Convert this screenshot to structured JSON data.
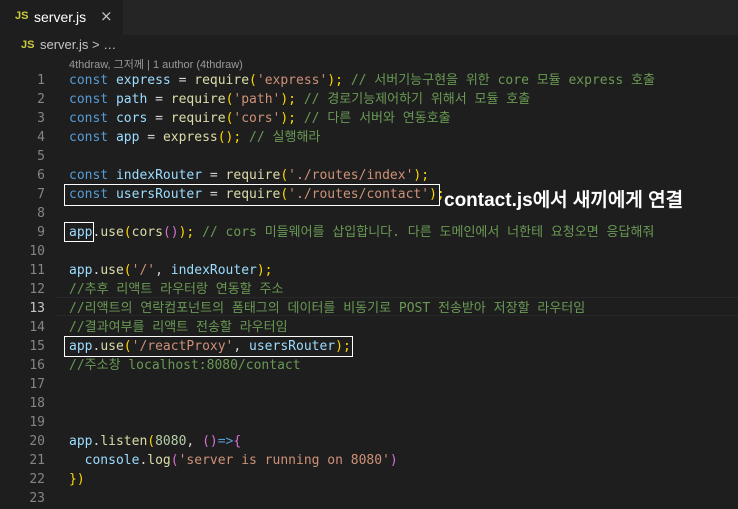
{
  "tab": {
    "icon": "JS",
    "file": "server.js",
    "close": "×"
  },
  "breadcrumb": {
    "icon": "JS",
    "path": "server.js > …"
  },
  "blame": "4thdraw, 그저께 | 1 author (4thdraw)",
  "line_numbers": [
    "1",
    "2",
    "3",
    "4",
    "5",
    "6",
    "7",
    "8",
    "9",
    "10",
    "11",
    "12",
    "13",
    "14",
    "15",
    "16",
    "17",
    "18",
    "19",
    "20",
    "21",
    "22",
    "23"
  ],
  "code": {
    "l1": [
      "const",
      "express",
      "=",
      "require",
      "(",
      "'express'",
      ");",
      "// 서버기능구현을 위한 core 모듈 express 호출"
    ],
    "l2": [
      "const",
      "path",
      "=",
      "require",
      "(",
      "'path'",
      ");",
      "// 경로기능제어하기 위해서 모듈 호출"
    ],
    "l3": [
      "const",
      "cors",
      "=",
      "require",
      "(",
      "'cors'",
      ");",
      "// 다른 서버와 연동호출"
    ],
    "l4": [
      "const",
      "app",
      "=",
      "express",
      "();",
      "// 실행해라"
    ],
    "l6": [
      "const",
      "indexRouter",
      "=",
      "require",
      "(",
      "'./routes/index'",
      ");"
    ],
    "l7": [
      "const",
      "usersRouter",
      "=",
      "require",
      "(",
      "'./routes/contact'",
      ");"
    ],
    "l9": [
      "app",
      ".",
      "use",
      "(",
      "cors",
      "()",
      ");",
      "// cors 미들웨어를 삽입합니다. 다른 도메인에서 너한테 요청오면 응답해줘"
    ],
    "l11": [
      "app",
      ".",
      "use",
      "(",
      "'/'",
      ",",
      "indexRouter",
      ");"
    ],
    "l12": [
      "//추후 리액트 라우터랑 연동할 주소"
    ],
    "l13": [
      "//리액트의 연락컴포넌트의 폼태그의 데이터를 비동기로 POST 전송받아 저장할 라우터임"
    ],
    "l14": [
      "//결과여부를 리액트 전송할 라우터임"
    ],
    "l15": [
      "app",
      ".",
      "use",
      "(",
      "'/reactProxy'",
      ",",
      "usersRouter",
      ");"
    ],
    "l16": [
      "//주소창 localhost:8080/contact"
    ],
    "l20": [
      "app",
      ".",
      "listen",
      "(",
      "8080",
      ",",
      "()",
      "=>",
      "{"
    ],
    "l21": [
      "console",
      ".",
      "log",
      "(",
      "'server is running on 8080'",
      ")"
    ],
    "l22": [
      "})"
    ]
  },
  "annotation": "contact.js에서 새끼에게 연결",
  "colors": {
    "keyword": "#569cd6",
    "variable": "#9cdcfe",
    "function": "#dcdcaa",
    "string": "#ce9178",
    "comment": "#6a9955",
    "number": "#b5cea8",
    "annotation_box": "#ffffff"
  }
}
